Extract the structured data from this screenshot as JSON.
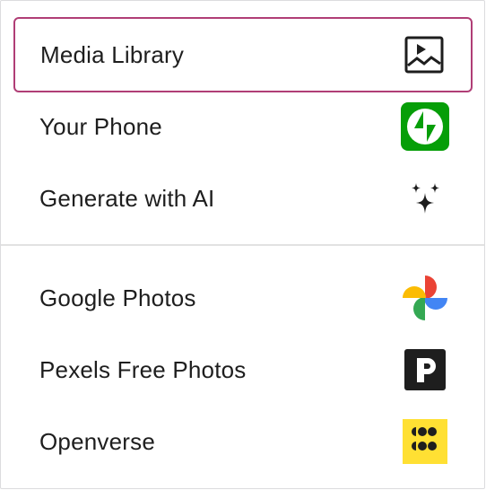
{
  "menu": {
    "groups": [
      {
        "items": [
          {
            "label": "Media Library",
            "icon": "image-icon"
          },
          {
            "label": "Your Phone",
            "icon": "jetpack-icon",
            "color": "#069e08"
          },
          {
            "label": "Generate with AI",
            "icon": "sparkles-icon"
          }
        ]
      },
      {
        "items": [
          {
            "label": "Google Photos",
            "icon": "google-photos-icon"
          },
          {
            "label": "Pexels Free Photos",
            "icon": "pexels-icon",
            "color": "#1e1e1e"
          },
          {
            "label": "Openverse",
            "icon": "openverse-icon",
            "color": "#ffe033"
          }
        ]
      }
    ],
    "focus_color": "#b03e76"
  }
}
